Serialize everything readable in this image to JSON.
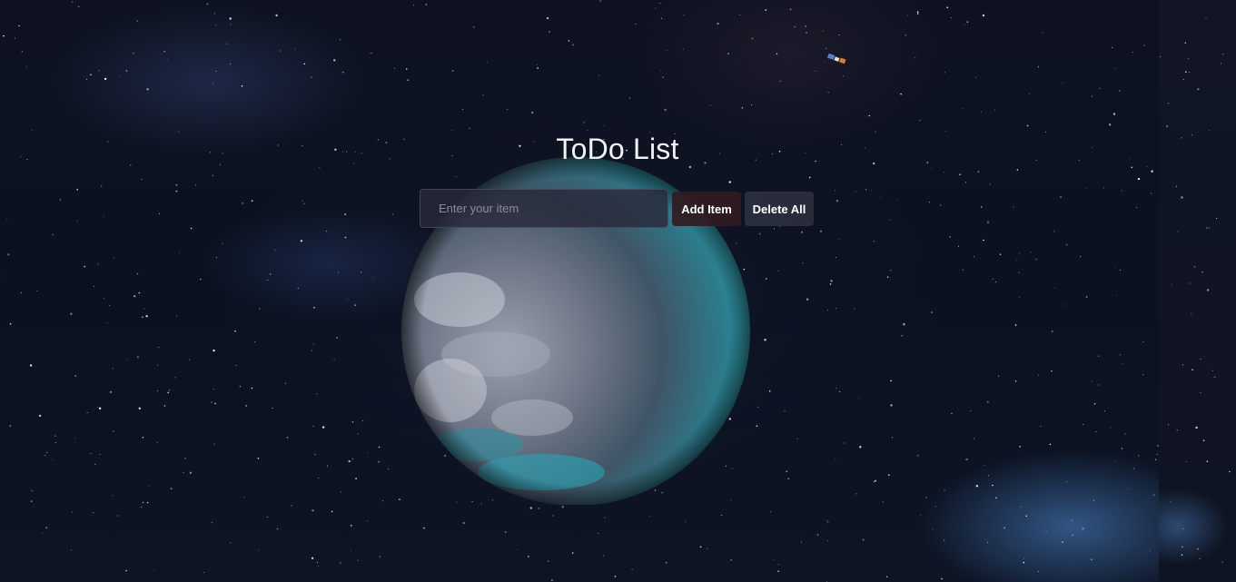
{
  "page": {
    "title": "ToDo List"
  },
  "form": {
    "input_placeholder": "Enter your item",
    "input_value": "",
    "add_button_label": "Add Item",
    "delete_all_button_label": "Delete All"
  },
  "background": {
    "description_icon": "earth-globe-icon",
    "satellite_icon": "satellite-icon"
  },
  "theme": {
    "space_color": "#0b1120",
    "text_color": "#f2f2f4",
    "add_button_color": "#301c22",
    "delete_button_color": "#2c2e3e"
  },
  "todo_items": []
}
